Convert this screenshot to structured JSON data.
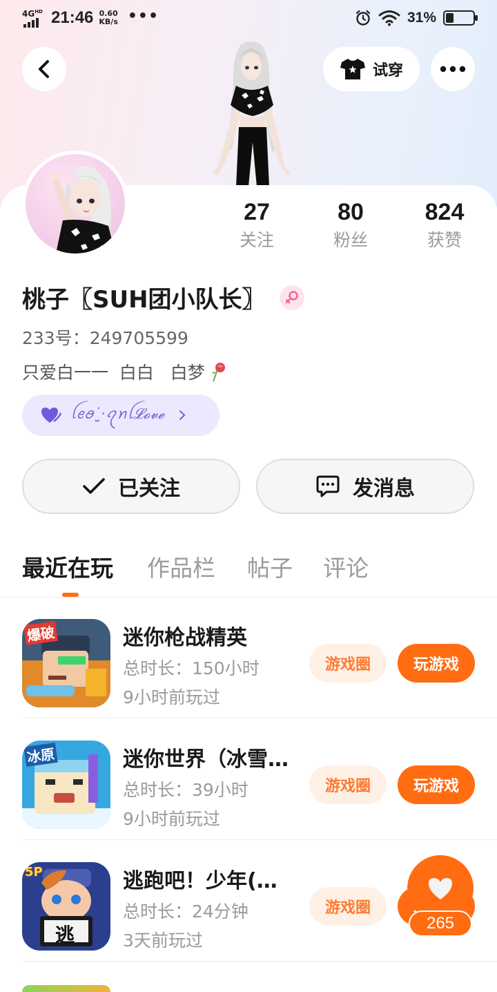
{
  "status_bar": {
    "network": "4G",
    "network_sup": "HD",
    "time": "21:46",
    "speed_value": "0.60",
    "speed_unit": "KB/s",
    "dots": "•••",
    "battery_pct": "31%",
    "battery_level": 0.31
  },
  "header": {
    "tryon_label": "试穿"
  },
  "profile": {
    "stats": [
      {
        "value": "27",
        "label": "关注"
      },
      {
        "value": "80",
        "label": "粉丝"
      },
      {
        "value": "824",
        "label": "获赞"
      }
    ],
    "name": "桃子〖SUH团小队长〗",
    "uid": "233号：249705599",
    "bio": "只爱白一一  白白   白梦",
    "love_tag": "ꪶꫀꪮ˙̫·ꪖꪀꪶ𝓛𝓸𝓿𝓮",
    "follow_label": "已关注",
    "message_label": "发消息"
  },
  "tabs": [
    {
      "label": "最近在玩",
      "active": true
    },
    {
      "label": "作品栏",
      "active": false
    },
    {
      "label": "帖子",
      "active": false
    },
    {
      "label": "评论",
      "active": false
    }
  ],
  "games": [
    {
      "title": "迷你枪战精英",
      "duration": "总时长：150小时",
      "last_played": "9小时前玩过",
      "badge": "爆破",
      "circle_label": "游戏圈",
      "play_label": "玩游戏"
    },
    {
      "title": "迷你世界（冰雪…",
      "duration": "总时长：39小时",
      "last_played": "9小时前玩过",
      "badge": "冰原",
      "circle_label": "游戏圈",
      "play_label": "玩游戏"
    },
    {
      "title": "逃跑吧！少年(…",
      "duration": "总时长：24分钟",
      "last_played": "3天前玩过",
      "badge": "逃",
      "circle_label": "游戏圈",
      "play_label": "玩游戏"
    }
  ],
  "like_float": {
    "count": "265"
  },
  "colors": {
    "accent": "#ff6c12",
    "accent_light": "#fff0e6",
    "tag_bg": "#ebe9fd",
    "tag_fg": "#7d6ad9"
  },
  "icons": {
    "back": "chevron-left-icon",
    "more": "more-dots-icon",
    "tryon": "tshirt-icon",
    "gender": "female-icon",
    "follow": "check-icon",
    "message": "chat-bubble-icon",
    "like": "heart-icon"
  }
}
